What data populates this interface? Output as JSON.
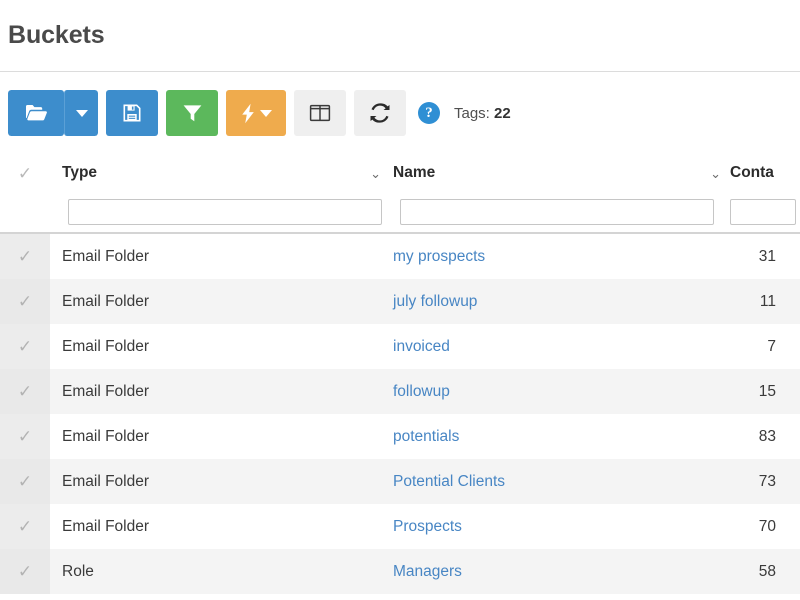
{
  "header": {
    "title": "Buckets"
  },
  "toolbar": {
    "open_button": {
      "label": "",
      "icon": "folder-open-icon"
    },
    "open_dropdown": {
      "label": "",
      "icon": "caret-down-icon"
    },
    "save_button": {
      "label": "",
      "icon": "floppy-disk-save-icon"
    },
    "filter_button": {
      "label": "",
      "icon": "funnel-filter-icon"
    },
    "actions_button": {
      "label": "",
      "icon": "lightning-bolt-icon"
    },
    "actions_dropdown": {
      "label": "",
      "icon": "caret-down-icon"
    },
    "columns_button": {
      "label": "",
      "icon": "columns-layout-icon"
    },
    "refresh_button": {
      "label": "",
      "icon": "refresh-sync-icon"
    },
    "help_button": {
      "label": "?",
      "icon": "question-mark-help-icon"
    },
    "tags_label": "Tags:",
    "tags_count": "22"
  },
  "table": {
    "columns": [
      {
        "key": "select",
        "label": "",
        "icon": "check-all-icon"
      },
      {
        "key": "type",
        "label": "Type",
        "sort_icon": "chevron-down-icon"
      },
      {
        "key": "name",
        "label": "Name",
        "sort_icon": "chevron-down-icon"
      },
      {
        "key": "contacts",
        "label": "Conta"
      }
    ],
    "filters": {
      "type_value": "",
      "type_placeholder": "",
      "name_value": "",
      "name_placeholder": "",
      "contacts_value": "",
      "contacts_placeholder": ""
    },
    "rows": [
      {
        "type": "Email Folder",
        "name": "my prospects",
        "contacts": "31"
      },
      {
        "type": "Email Folder",
        "name": "july followup",
        "contacts": "11"
      },
      {
        "type": "Email Folder",
        "name": "invoiced",
        "contacts": "7"
      },
      {
        "type": "Email Folder",
        "name": "followup",
        "contacts": "15"
      },
      {
        "type": "Email Folder",
        "name": "potentials",
        "contacts": "83"
      },
      {
        "type": "Email Folder",
        "name": "Potential Clients",
        "contacts": "73"
      },
      {
        "type": "Email Folder",
        "name": "Prospects",
        "contacts": "70"
      },
      {
        "type": "Role",
        "name": "Managers",
        "contacts": "58"
      }
    ],
    "row_check_icon": "check-mark-icon"
  },
  "colors": {
    "primary_blue": "#3d8dcc",
    "success_green": "#5cb85c",
    "warning_orange": "#efab4d",
    "neutral_grey": "#efefef",
    "link_blue": "#4886c4",
    "help_blue": "#2f8fd4",
    "row_stripe": "#f4f4f4",
    "check_column": "#ececec"
  }
}
